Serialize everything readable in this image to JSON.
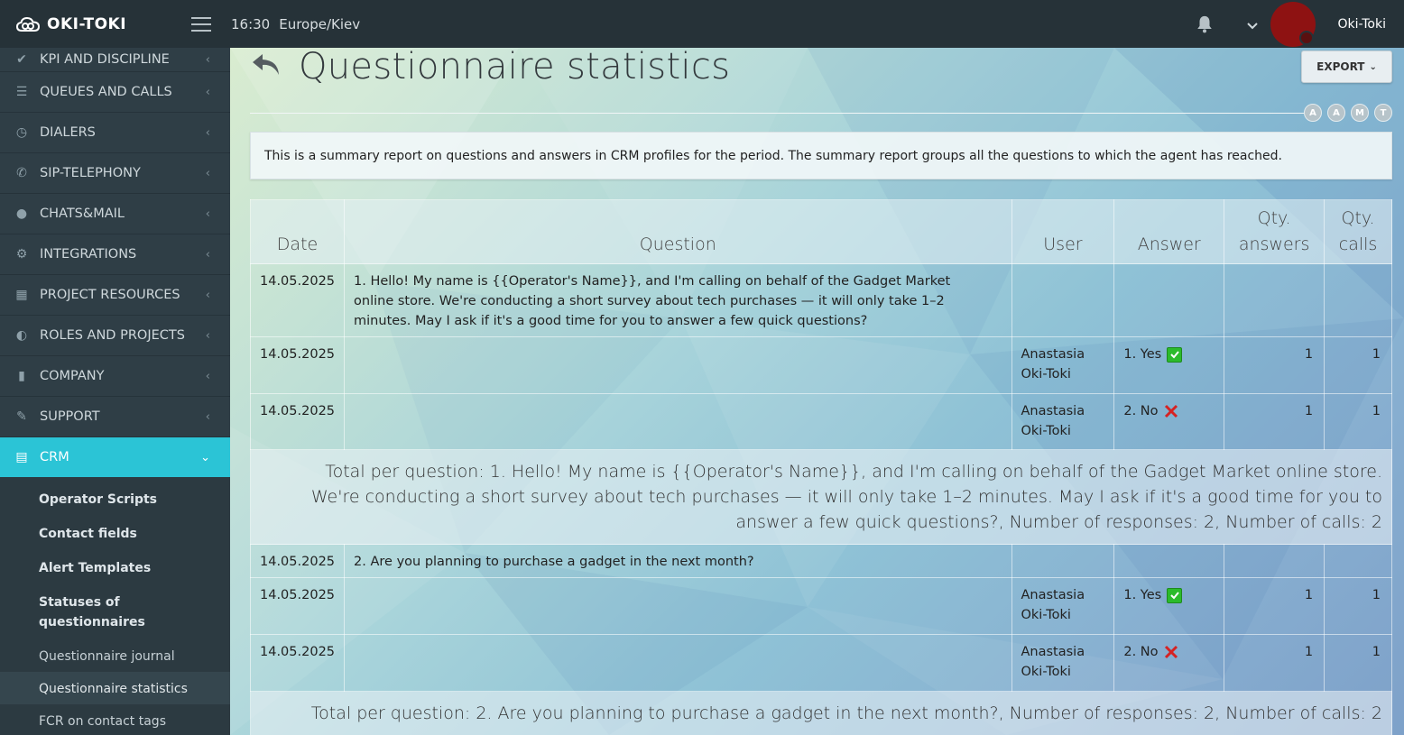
{
  "topbar": {
    "brand": "OKI-TOKI",
    "time": "16:30",
    "timezone": "Europe/Kiev",
    "username": "Oki-Toki"
  },
  "sidebar": {
    "items": [
      {
        "label": "KPI AND DISCIPLINE",
        "icon": "check-icon"
      },
      {
        "label": "QUEUES AND CALLS",
        "icon": "list-icon"
      },
      {
        "label": "DIALERS",
        "icon": "clock-icon"
      },
      {
        "label": "SIP-TELEPHONY",
        "icon": "phone-icon"
      },
      {
        "label": "CHATS&MAIL",
        "icon": "chat-bubble-icon"
      },
      {
        "label": "INTEGRATIONS",
        "icon": "gears-icon"
      },
      {
        "label": "PROJECT RESOURCES",
        "icon": "grid-icon"
      },
      {
        "label": "ROLES AND PROJECTS",
        "icon": "toggle-icon"
      },
      {
        "label": "COMPANY",
        "icon": "bar-chart-icon"
      },
      {
        "label": "SUPPORT",
        "icon": "wrench-icon"
      }
    ],
    "active": {
      "label": "CRM",
      "icon": "crm-card-icon"
    },
    "subitems": [
      "Operator Scripts",
      "Contact fields",
      "Alert Templates",
      "Statuses of questionnaires",
      "Questionnaire journal",
      "Questionnaire statistics",
      "FCR on contact tags"
    ]
  },
  "page": {
    "title": "Questionnaire statistics",
    "export_label": "EXPORT",
    "filter_badges": [
      "A",
      "A",
      "M",
      "T"
    ],
    "info": "This is a summary report on questions and answers in CRM profiles for the period. The summary report groups all the questions to which the agent has reached."
  },
  "table": {
    "headers": {
      "date": "Date",
      "question": "Question",
      "user": "User",
      "answer": "Answer",
      "qty_answers": "Qty. answers",
      "qty_calls": "Qty. calls"
    },
    "rows": [
      {
        "date": "14.05.2025",
        "question": "1. Hello! My name is {{Operator's Name}}, and I'm calling on behalf of the Gadget Market online store. We're conducting a short survey about tech purchases — it will only take 1–2 minutes. May I ask if it's a good time for you to answer a few quick questions?",
        "user": "",
        "answer": "",
        "qty_answers": "",
        "qty_calls": ""
      },
      {
        "date": "14.05.2025",
        "question": "",
        "user": "Anastasia Oki-Toki",
        "answer": "1. Yes",
        "mark": "yes",
        "qty_answers": "1",
        "qty_calls": "1"
      },
      {
        "date": "14.05.2025",
        "question": "",
        "user": "Anastasia Oki-Toki",
        "answer": "2. No",
        "mark": "no",
        "qty_answers": "1",
        "qty_calls": "1"
      },
      {
        "total": "Total per question: 1. Hello! My name is {{Operator's Name}}, and I'm calling on behalf of the Gadget Market online store. We're conducting a short survey about tech purchases — it will only take 1–2 minutes. May I ask if it's a good time for you to answer a few quick questions?, Number of responses: 2, Number of calls: 2"
      },
      {
        "date": "14.05.2025",
        "question": "2. Are you planning to purchase a gadget in the next month?",
        "user": "",
        "answer": "",
        "qty_answers": "",
        "qty_calls": ""
      },
      {
        "date": "14.05.2025",
        "question": "",
        "user": "Anastasia Oki-Toki",
        "answer": "1. Yes",
        "mark": "yes",
        "qty_answers": "1",
        "qty_calls": "1"
      },
      {
        "date": "14.05.2025",
        "question": "",
        "user": "Anastasia Oki-Toki",
        "answer": "2. No",
        "mark": "no",
        "qty_answers": "1",
        "qty_calls": "1"
      },
      {
        "total": "Total per question: 2. Are you planning to purchase a gadget in the next month?, Number of responses: 2, Number of calls: 2"
      }
    ]
  },
  "colors": {
    "topbar": "#263238",
    "sidebar": "#2f3e46",
    "active_nav": "#2bc4d6",
    "yes_mark": "#2bbb2b",
    "no_mark": "#d62222"
  }
}
